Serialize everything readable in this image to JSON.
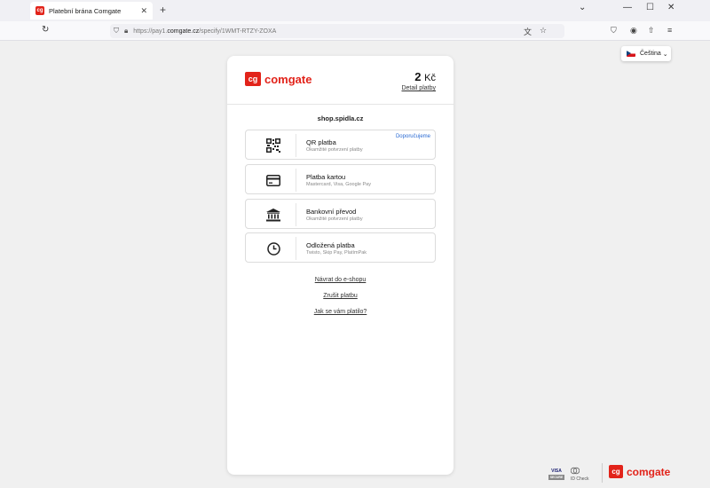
{
  "browser": {
    "tab_title": "Platební brána Comgate",
    "tab_favicon": "cg",
    "url_prefix": "https://pay1.",
    "url_domain": "comgate.cz",
    "url_path": "/specify/1WMT-RTZY-ZOXA"
  },
  "language": {
    "label": "Čeština",
    "flag_icon": "czech-flag-icon"
  },
  "header": {
    "logo_mark": "cg",
    "logo_text": "comgate",
    "price_amount": "2",
    "price_currency": "Kč",
    "price_detail": "Detail platby"
  },
  "shop": "shop.spidla.cz",
  "options": [
    {
      "title": "QR platba",
      "subtitle": "Okamžité potvrzení platby",
      "badge": "Doporučujeme",
      "icon": "qr-code-icon"
    },
    {
      "title": "Platba kartou",
      "subtitle": "Mastercard, Visa, Google Pay",
      "icon": "credit-card-icon"
    },
    {
      "title": "Bankovní převod",
      "subtitle": "Okamžité potvrzení platby",
      "icon": "bank-icon"
    },
    {
      "title": "Odložená platba",
      "subtitle": "Twisto, Skip Pay, PlatímPak",
      "icon": "clock-icon"
    }
  ],
  "links": {
    "back": "Návrat do e-shopu",
    "cancel": "Zrušit platbu",
    "feedback": "Jak se vám platilo?"
  },
  "footer": {
    "visa": "VISA",
    "visa_secure": "SECURE",
    "id_check": "ID Check",
    "logo_mark": "cg",
    "logo_text": "comgate"
  },
  "colors": {
    "brand": "#e2231a",
    "recommend": "#2a6ad3"
  }
}
